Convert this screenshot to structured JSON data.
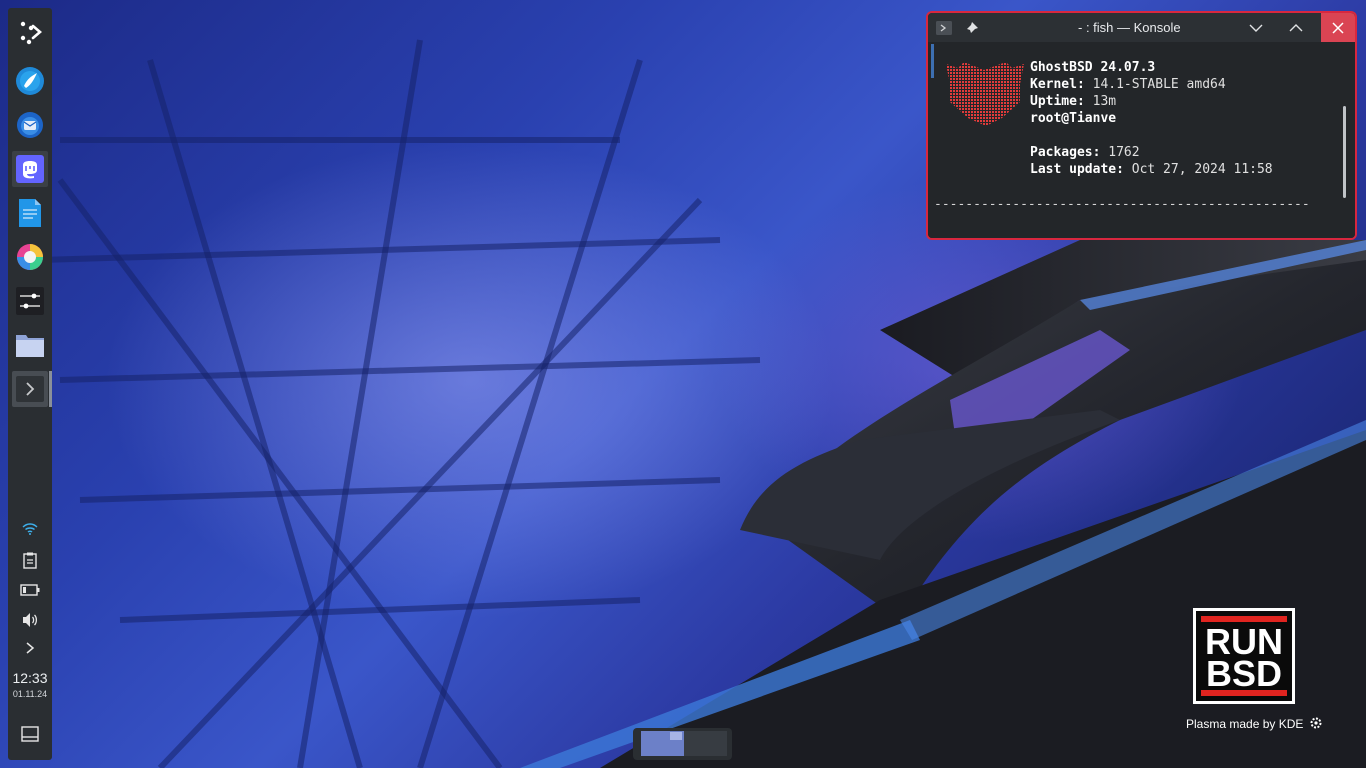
{
  "konsole": {
    "title": "- : fish — Konsole",
    "os_label": "GhostBSD",
    "os_value": " 24.07.3",
    "kernel_label": "Kernel:",
    "kernel_value": " 14.1-STABLE amd64",
    "uptime_label": "Uptime:",
    "uptime_value": " 13m",
    "user_host": "root@Tianve",
    "packages_label": "Packages:",
    "packages_value": " 1762",
    "update_label": "Last update:",
    "update_value": " Oct 27, 2024 11:58",
    "separator": "------------------------------------------------"
  },
  "panel": {
    "launchers": [
      "application-launcher",
      "browser",
      "thunderbird",
      "mastodon",
      "text-editor",
      "color-picker",
      "settings",
      "file-manager",
      "konsole"
    ],
    "tray": [
      "wifi-icon",
      "clipboard-icon",
      "battery-icon",
      "volume-icon",
      "expand-icon"
    ]
  },
  "clock": {
    "time": "12:33",
    "date": "01.11.24"
  },
  "runbsd": {
    "line1": "RUN",
    "line2": "BSD"
  },
  "kde_credit": "Plasma made by KDE",
  "colors": {
    "accent": "#3daee9",
    "close": "#da4453",
    "active_border": "#d8273f",
    "panel": "#2a2e32"
  }
}
